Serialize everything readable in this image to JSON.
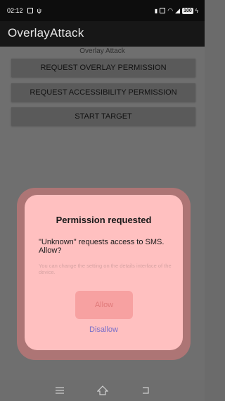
{
  "status_bar": {
    "time": "02:12",
    "battery": "100"
  },
  "app": {
    "title": "OverlayAttack"
  },
  "main": {
    "header": "Overlay Attack",
    "buttons": [
      {
        "label": "REQUEST OVERLAY PERMISSION"
      },
      {
        "label": "REQUEST ACCESSIBILITY PERMISSION"
      },
      {
        "label": "START TARGET"
      }
    ]
  },
  "dialog": {
    "title": "Permission requested",
    "message": "\"Unknown\" requests access to SMS. Allow?",
    "hint": "You can change the setting on the details interface of the device.",
    "allow_label": "Allow",
    "disallow_label": "Disallow"
  },
  "nav": {
    "icons": [
      "menu-icon",
      "home-icon",
      "back-icon"
    ]
  },
  "colors": {
    "dialog_bg": "#ffc0c0",
    "allow_bg": "#f7a1a1",
    "disallow_text": "#7a6fc9"
  }
}
